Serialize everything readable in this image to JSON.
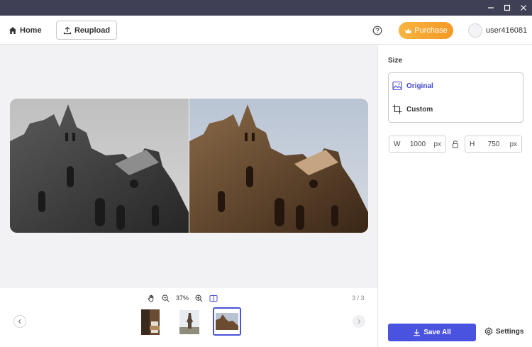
{
  "header": {
    "home_label": "Home",
    "reupload_label": "Reupload",
    "purchase_label": "Purchase",
    "username": "user416081"
  },
  "viewer": {
    "zoom": "37%",
    "page_count": "3 / 3",
    "thumbnails": [
      "thumbnail-1",
      "thumbnail-2",
      "thumbnail-3"
    ],
    "active_thumbnail": 3
  },
  "panel": {
    "size_title": "Size",
    "options": [
      "Original",
      "Custom"
    ],
    "selected_option": "Original",
    "width_label": "W",
    "width_value": "1000",
    "height_label": "H",
    "height_value": "750",
    "unit": "px",
    "save_all_label": "Save All",
    "settings_label": "Settings"
  },
  "colors": {
    "accent": "#4a52e0",
    "purchase": "#f5a12d",
    "titlebar": "#3f3f55"
  },
  "icons": [
    "home-icon",
    "upload-icon",
    "help-icon",
    "crown-icon",
    "hand-icon",
    "zoom-out-icon",
    "zoom-in-icon",
    "compare-icon",
    "image-icon",
    "crop-icon",
    "lock-icon",
    "download-icon",
    "gear-icon"
  ]
}
